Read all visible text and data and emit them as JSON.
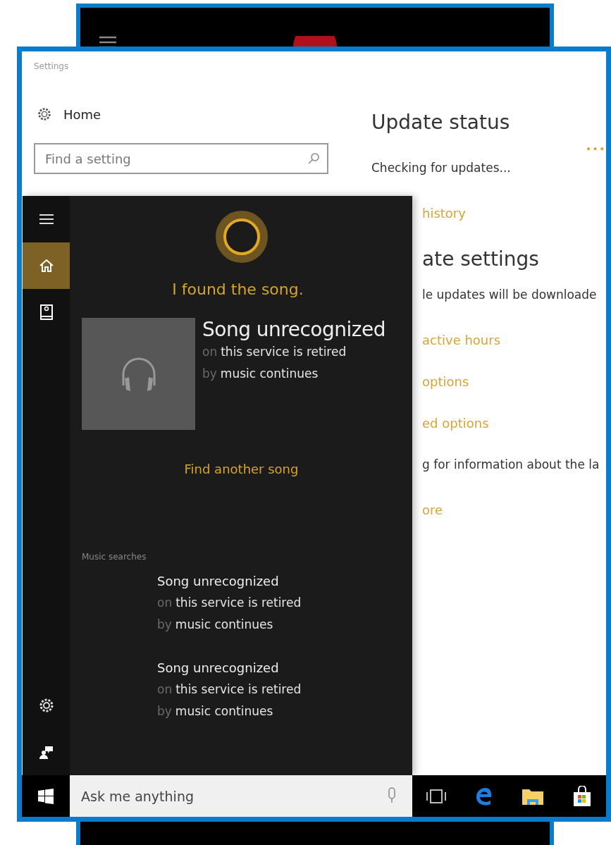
{
  "settings": {
    "title": "Settings",
    "home": "Home",
    "search": {
      "placeholder": "Find a setting"
    },
    "status": [
      {
        "kind": "heading",
        "text": "Update status"
      },
      {
        "kind": "progress",
        "text": "..."
      },
      {
        "kind": "text",
        "text": "Checking for updates..."
      }
    ],
    "covered": [
      {
        "kind": "link",
        "text": "history"
      },
      {
        "kind": "heading",
        "text": "ate settings"
      },
      {
        "kind": "text",
        "text": "le updates will be downloade"
      },
      {
        "kind": "link",
        "text": "active hours"
      },
      {
        "kind": "link",
        "text": "options"
      },
      {
        "kind": "link",
        "text": "ed options"
      },
      {
        "kind": "text",
        "text": "g for information about the la"
      },
      {
        "kind": "link",
        "text": "ore"
      }
    ]
  },
  "cortana": {
    "rail": [
      {
        "kind": "menu",
        "selected": false
      },
      {
        "kind": "home",
        "selected": true
      },
      {
        "kind": "notebook",
        "selected": false
      }
    ],
    "rail_bottom": [
      {
        "kind": "settings"
      },
      {
        "kind": "feedback"
      }
    ],
    "message": "I found the song.",
    "song": {
      "title": "Song unrecognized",
      "lines": [
        {
          "prefix": "on",
          "value": "this service is retired"
        },
        {
          "prefix": "by",
          "value": "music continues"
        }
      ]
    },
    "action": "Find another song",
    "section": "Music searches",
    "results": [
      {
        "title": "Song unrecognized",
        "lines": [
          {
            "prefix": "on",
            "value": "this service is retired"
          },
          {
            "prefix": "by",
            "value": "music continues"
          }
        ]
      },
      {
        "title": "Song unrecognized",
        "lines": [
          {
            "prefix": "on",
            "value": "this service is retired"
          },
          {
            "prefix": "by",
            "value": "music continues"
          }
        ]
      }
    ],
    "search": {
      "placeholder": "Ask me anything"
    }
  },
  "taskbar": [
    {
      "kind": "taskview"
    },
    {
      "kind": "edge"
    },
    {
      "kind": "folder"
    },
    {
      "kind": "store"
    }
  ]
}
